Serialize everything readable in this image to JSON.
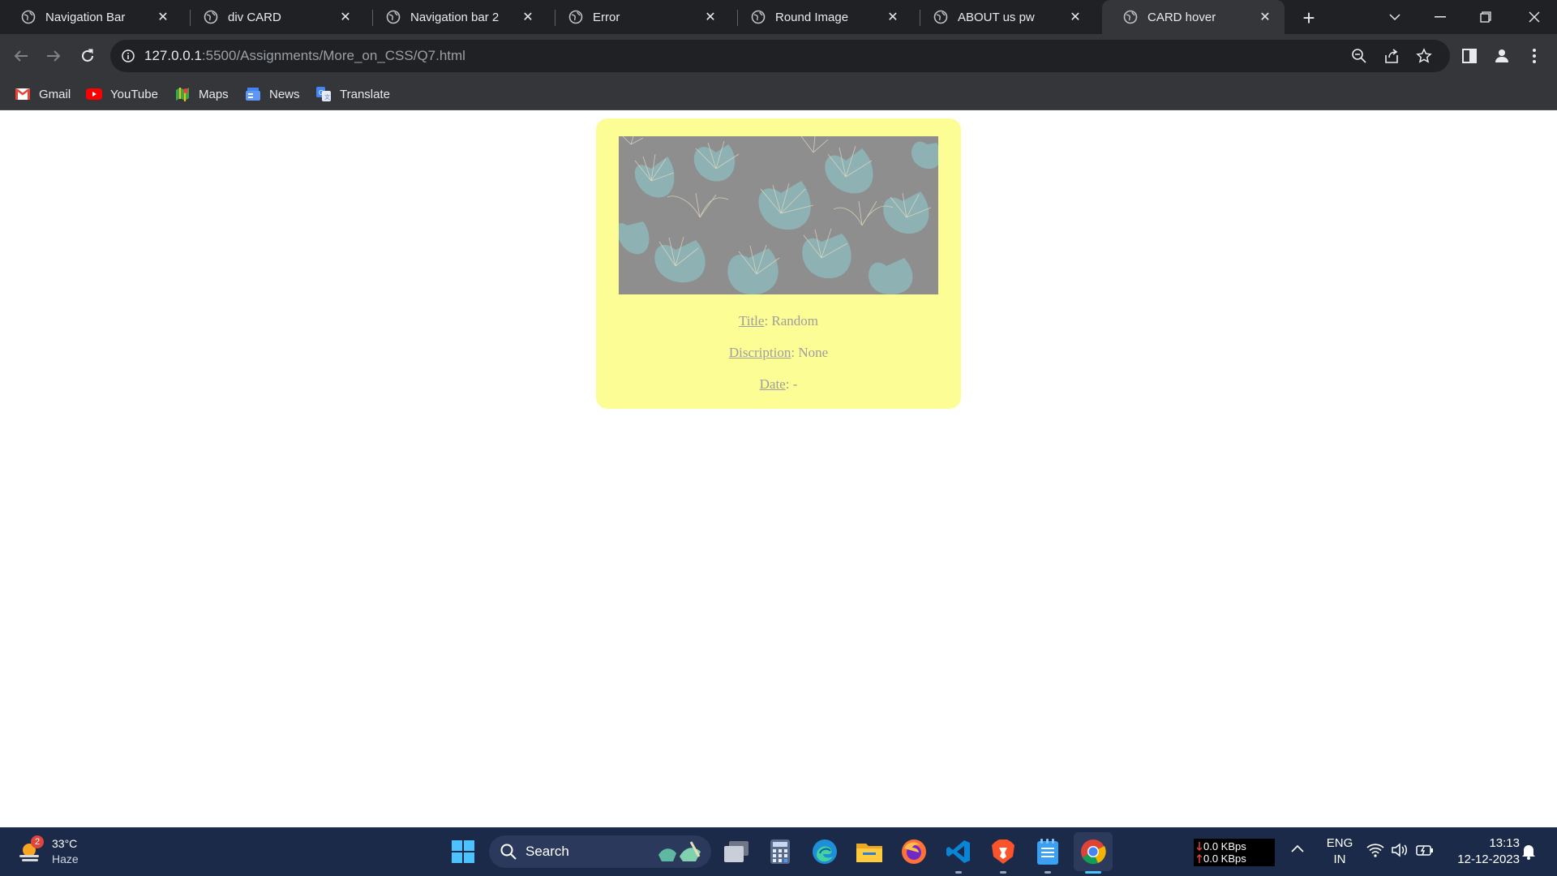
{
  "tabs": [
    {
      "label": "Navigation Bar",
      "active": false
    },
    {
      "label": "div CARD",
      "active": false
    },
    {
      "label": "Navigation bar 2",
      "active": false
    },
    {
      "label": "Error",
      "active": false
    },
    {
      "label": "Round Image",
      "active": false
    },
    {
      "label": "ABOUT us pw",
      "active": false
    },
    {
      "label": "CARD hover",
      "active": true
    }
  ],
  "address": {
    "host": "127.0.0.1",
    "rest": ":5500/Assignments/More_on_CSS/Q7.html"
  },
  "bookmarks": [
    {
      "label": "Gmail",
      "icon": "gmail-icon"
    },
    {
      "label": "YouTube",
      "icon": "youtube-icon"
    },
    {
      "label": "Maps",
      "icon": "maps-icon"
    },
    {
      "label": "News",
      "icon": "news-icon"
    },
    {
      "label": "Translate",
      "icon": "translate-icon"
    }
  ],
  "card": {
    "title_label": "Title",
    "title_value": ": Random",
    "description_label": "Discription",
    "description_value": ": None",
    "date_label": "Date",
    "date_value": ": -",
    "background": "#fdfd96",
    "image_description_color": "#8e8e8e"
  },
  "taskbar": {
    "weather_temp": "33°C",
    "weather_desc": "Haze",
    "weather_badge": "2",
    "search_label": "Search",
    "net_down": "0.0 KBps",
    "net_up": "0.0 KBps",
    "lang_top": "ENG",
    "lang_bottom": "IN",
    "time": "13:13",
    "date": "12-12-2023"
  },
  "colors": {
    "tabstrip": "#202124",
    "toolbar": "#35363a",
    "taskbar": "#1c2a4a"
  }
}
